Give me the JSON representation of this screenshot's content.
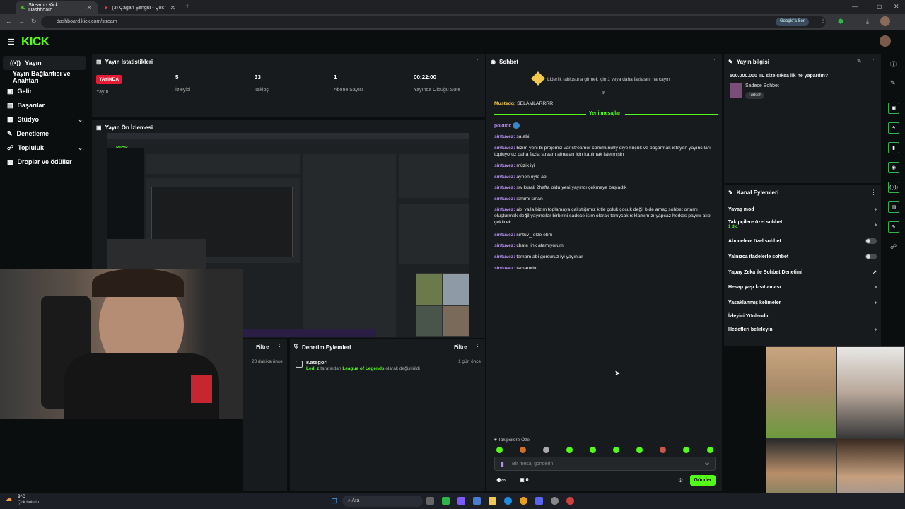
{
  "browser": {
    "tabs": [
      {
        "title": "Stream - Kick Dashboard",
        "active": true
      },
      {
        "title": "(3) Çağan Şengül - Çok Ya…",
        "active": false
      }
    ],
    "url": "dashboard.kick.com/stream",
    "google_button": "Google'a Sor"
  },
  "app": {
    "logo": "KICK"
  },
  "sidebar": {
    "items": [
      {
        "label": "Yayın",
        "icon": "broadcast-icon"
      },
      {
        "label": "Yayın Bağlantısı ve Anahtarı",
        "icon": ""
      },
      {
        "label": "Gelir",
        "icon": "dollar-icon"
      },
      {
        "label": "Başarılar",
        "icon": "trophy-icon"
      },
      {
        "label": "Stüdyo",
        "icon": "studio-icon"
      },
      {
        "label": "Denetleme",
        "icon": "wrench-icon"
      },
      {
        "label": "Topluluk",
        "icon": "community-icon"
      },
      {
        "label": "Droplar ve ödüller",
        "icon": "gift-icon"
      }
    ]
  },
  "stats": {
    "title": "Yayın İstatistikleri",
    "live_badge": "YAYINDA",
    "live_label": "Yayın",
    "viewers": "5",
    "viewers_label": "İzleyici",
    "followers": "33",
    "followers_label": "Takipçi",
    "subs": "1",
    "subs_label": "Abone Sayısı",
    "uptime": "00:22:00",
    "uptime_label": "Yayında Olduğu Süre"
  },
  "preview": {
    "title": "Yayın Ön İzlemesi"
  },
  "filter_panel": {
    "filter": "Filtre",
    "time": "20 dakika önce"
  },
  "moderation": {
    "title": "Denetim Eylemleri",
    "filter": "Filtre",
    "event_title": "Kategori",
    "event_user": "Led_z",
    "event_mid": " tarafından ",
    "event_cat": "League of Legends",
    "event_end": " olarak değiştirildi",
    "event_time": "1 gün önce"
  },
  "chat": {
    "title": "Sohbet",
    "leaderboard": "Liderlik tablosuna girmek için 1  veya daha fazlasını harcayın",
    "pinned_user": "Mustedq:",
    "pinned_text": " SELAMLARRRR",
    "new_messages": "Yeni mesajlar",
    "messages": [
      {
        "user": "poldiol:",
        "text": ""
      },
      {
        "user": "sintuvez:",
        "text": " sa abi"
      },
      {
        "user": "sintuvez:",
        "text": " bizim yeni bi projemiz var streamer communutly diye küçük ve başarmak isteyen yayıncıları topluyoruz daha fazla stream almaları için katılmak istermisin"
      },
      {
        "user": "sintuvez:",
        "text": " müzik iyi"
      },
      {
        "user": "sintuvez:",
        "text": " aynen öyle abi"
      },
      {
        "user": "sintuvez:",
        "text": " sw kurali 2hafta oldu yeni yayıncı çekmeye başladık"
      },
      {
        "user": "sintuvez:",
        "text": " ismimi sinan"
      },
      {
        "user": "sintuvez:",
        "text": " abi valla bizim toplamaya çalıştığımız kitle çoluk çocuk değil bide amaç sohbet ortamı oluşturmak değil yayıncılar birbirini sadece isim olarak tanıycak reklamımızı yapcaz herkes payını alıp çekilcek"
      },
      {
        "user": "sintuvez:",
        "text": " sintuv_ ekle ebni"
      },
      {
        "user": "sintuvez:",
        "text": " chate link atamıyorum"
      },
      {
        "user": "sintuvez:",
        "text": " tamam abi gorsuruz iyi yayınlar"
      },
      {
        "user": "sintuvez:",
        "text": " tamamdır"
      }
    ],
    "followers_only": "Takipçilere Özel",
    "input_placeholder": "Bir mesaj gönderin",
    "send": "Gönder",
    "points": "0"
  },
  "stream_info": {
    "title": "Yayın bilgisi",
    "stream_title": "500.000.000 TL size çıksa ilk ne yapardın?",
    "category": "Sadece Sohbet",
    "tag": "Turkish"
  },
  "channel_actions": {
    "title": "Kanal Eylemleri",
    "items": [
      {
        "label": "Yavaş mod",
        "sub": "",
        "control": "chevron"
      },
      {
        "label": "Takipçilere özel sohbet",
        "sub": "1 dk.",
        "control": "chevron"
      },
      {
        "label": "Abonelere özel sohbet",
        "sub": "",
        "control": "toggle"
      },
      {
        "label": "Yalnızca ifadelerle sohbet",
        "sub": "",
        "control": "toggle"
      },
      {
        "label": "Yapay Zeka ile Sohbet Denetimi",
        "sub": "",
        "control": "external"
      },
      {
        "label": "Hesap yaşı kısıtlaması",
        "sub": "",
        "control": "chevron"
      },
      {
        "label": "Yasaklanmış kelimeler",
        "sub": "",
        "control": "chevron"
      },
      {
        "label": "İzleyici Yönlendir",
        "sub": "",
        "control": "none"
      },
      {
        "label": "Hedefleri belirleyin",
        "sub": "",
        "control": "chevron"
      }
    ]
  },
  "taskbar": {
    "weather_temp": "9°C",
    "weather_desc": "Çok bulutlu",
    "search": "Ara"
  },
  "colors": {
    "accent": "#53fc18",
    "live": "#e71a34",
    "username": "#b48cf2"
  }
}
